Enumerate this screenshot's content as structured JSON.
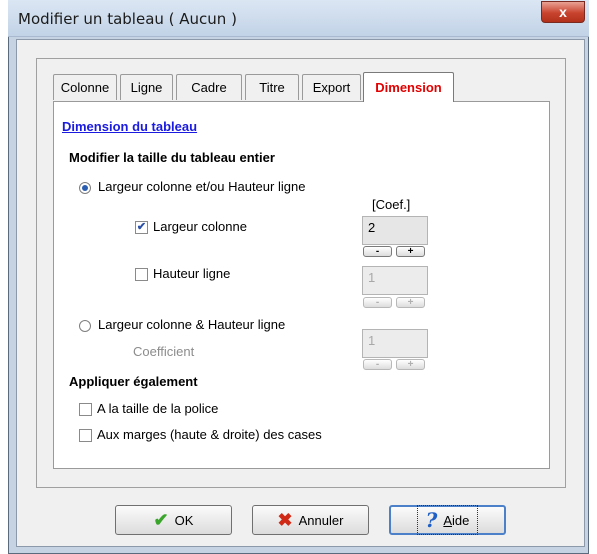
{
  "window": {
    "title": "Modifier un tableau ( Aucun )",
    "close_glyph": "x"
  },
  "tabs": [
    {
      "label": "Colonne"
    },
    {
      "label": "Ligne"
    },
    {
      "label": "Cadre"
    },
    {
      "label": "Titre"
    },
    {
      "label": "Export"
    },
    {
      "label": "Dimension",
      "active": true
    }
  ],
  "panel": {
    "title": "Dimension du tableau",
    "section1_heading": "Modifier la taille du tableau entier",
    "radio1_label": "Largeur colonne et/ou Hauteur ligne",
    "coef_label": "[Coef.]",
    "check_largeur_label": "Largeur colonne",
    "check_largeur_checked": true,
    "largeur_value": "2",
    "check_hauteur_label": "Hauteur ligne",
    "check_hauteur_checked": false,
    "hauteur_value": "1",
    "radio2_label": "Largeur colonne & Hauteur ligne",
    "coefficient_label": "Coefficient",
    "coefficient_value": "1",
    "spin_minus": "-",
    "spin_plus": "+",
    "section2_heading": "Appliquer également",
    "check_police_label": "A la taille de la police",
    "check_marges_label": "Aux marges (haute & droite) des cases"
  },
  "buttons": {
    "ok_label": "OK",
    "cancel_label": "Annuler",
    "help_label": "Aide"
  },
  "colors": {
    "active_tab_text": "#e30000",
    "link_title": "#1a1ae0",
    "close_button": "#c8432e",
    "ok_icon": "#3aa52b",
    "cancel_icon": "#d02a16",
    "help_icon": "#1f5fc6"
  }
}
